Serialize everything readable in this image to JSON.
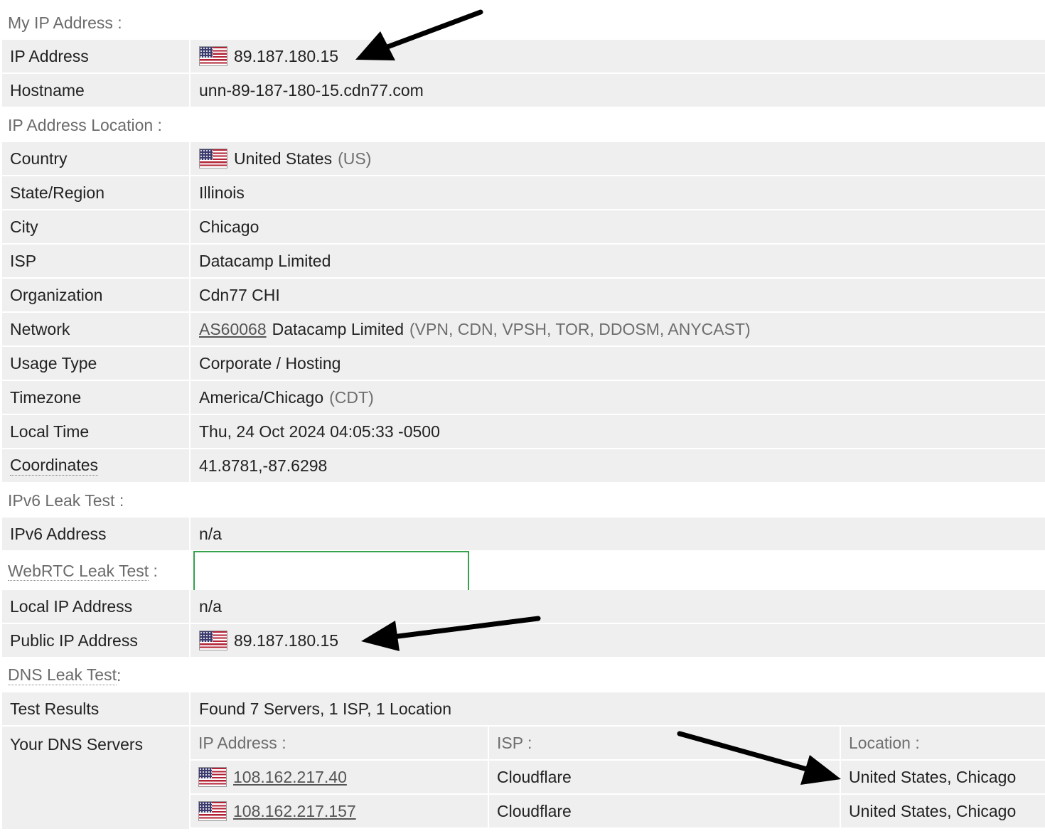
{
  "sections": {
    "my_ip": "My IP Address :",
    "location": "IP Address Location :",
    "ipv6": "IPv6 Leak Test :",
    "webrtc": "WebRTC Leak Test",
    "webrtc_colon": " :",
    "dns": "DNS Leak Test",
    "dns_colon": " :"
  },
  "my_ip": {
    "ip_label": "IP Address",
    "ip_value": "89.187.180.15",
    "hostname_label": "Hostname",
    "hostname_value": "unn-89-187-180-15.cdn77.com"
  },
  "location": {
    "country_label": "Country",
    "country_value": "United States",
    "country_code": "(US)",
    "state_label": "State/Region",
    "state_value": "Illinois",
    "city_label": "City",
    "city_value": "Chicago",
    "isp_label": "ISP",
    "isp_value": "Datacamp Limited",
    "org_label": "Organization",
    "org_value": "Cdn77 CHI",
    "network_label": "Network",
    "network_asn": "AS60068",
    "network_name": "Datacamp Limited",
    "network_tags": "(VPN, CDN, VPSH, TOR, DDOSM, ANYCAST)",
    "usage_label": "Usage Type",
    "usage_value": "Corporate / Hosting",
    "tz_label": "Timezone",
    "tz_value": "America/Chicago",
    "tz_abbr": "(CDT)",
    "time_label": "Local Time",
    "time_value": "Thu, 24 Oct 2024 04:05:33 -0500",
    "coords_label": "Coordinates",
    "coords_value": "41.8781,-87.6298"
  },
  "ipv6": {
    "label": "IPv6 Address",
    "value": "n/a"
  },
  "webrtc": {
    "local_label": "Local IP Address",
    "local_value": "n/a",
    "public_label": "Public IP Address",
    "public_value": "89.187.180.15"
  },
  "dns": {
    "results_label": "Test Results",
    "results_value": "Found 7 Servers, 1 ISP, 1 Location",
    "servers_label": "Your DNS Servers",
    "columns": [
      "IP Address :",
      "ISP :",
      "Location :"
    ],
    "servers": [
      {
        "ip": "108.162.217.40",
        "isp": "Cloudflare",
        "location": "United States, Chicago"
      },
      {
        "ip": "108.162.217.157",
        "isp": "Cloudflare",
        "location": "United States, Chicago"
      }
    ]
  },
  "colors": {
    "row_bg": "#efefef",
    "section_text": "#6b6b6b",
    "webrtc_border": "#34a34a",
    "arrow": "#000000"
  }
}
